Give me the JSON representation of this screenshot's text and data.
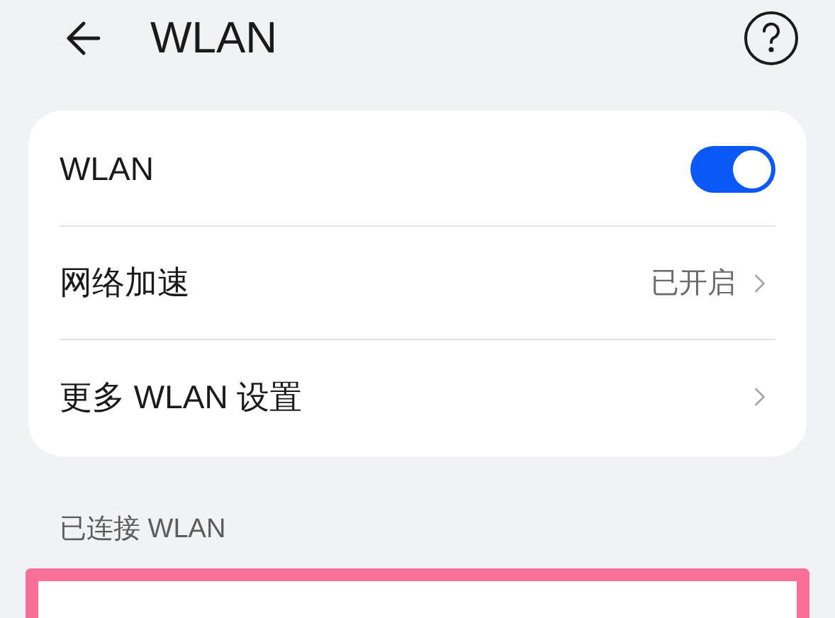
{
  "header": {
    "title": "WLAN"
  },
  "settings": [
    {
      "kind": "toggle",
      "label": "WLAN",
      "on": true
    },
    {
      "kind": "link",
      "label": "网络加速",
      "value": "已开启"
    },
    {
      "kind": "link",
      "label": "更多 WLAN 设置"
    }
  ],
  "section": {
    "label": "已连接 WLAN",
    "highlighted": true
  }
}
